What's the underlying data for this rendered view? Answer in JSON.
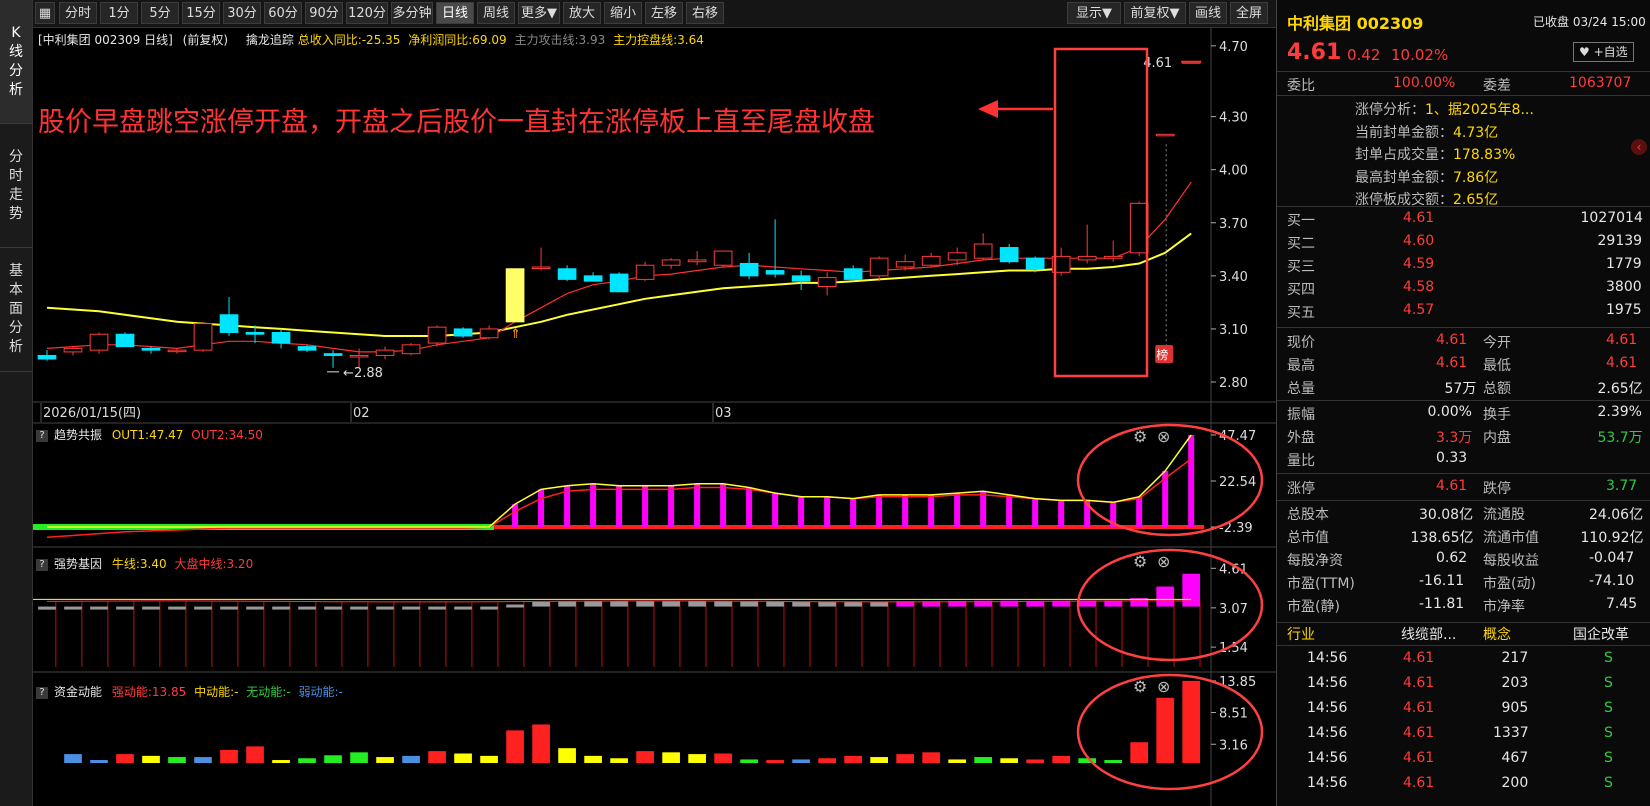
{
  "left_tabs": [
    {
      "label": "K\n线\n分\n析",
      "active": true
    },
    {
      "label": "分\n时\n走\n势",
      "active": false
    },
    {
      "label": "基\n本\n面\n分\n析",
      "active": false
    }
  ],
  "toolbar": {
    "period_buttons": [
      {
        "label": "分时",
        "active": false
      },
      {
        "label": "1分",
        "active": false
      },
      {
        "label": "5分",
        "active": false
      },
      {
        "label": "15分",
        "active": false
      },
      {
        "label": "30分",
        "active": false
      },
      {
        "label": "60分",
        "active": false
      },
      {
        "label": "90分",
        "active": false
      },
      {
        "label": "120分",
        "active": false
      },
      {
        "label": "多分钟",
        "active": false
      },
      {
        "label": "日线",
        "active": true
      },
      {
        "label": "周线",
        "active": false
      },
      {
        "label": "更多▼",
        "active": false
      },
      {
        "label": "放大",
        "active": false
      },
      {
        "label": "缩小",
        "active": false
      },
      {
        "label": "左移",
        "active": false
      },
      {
        "label": "右移",
        "active": false
      }
    ],
    "right_buttons": [
      {
        "label": "显示▼"
      },
      {
        "label": "前复权▼"
      },
      {
        "label": "画线"
      },
      {
        "label": "全屏"
      }
    ]
  },
  "main_chart": {
    "title": "[中利集团 002309 日线]",
    "adjust": "(前复权)",
    "indicator_name": "擒龙追踪",
    "ind1": "总收入同比:-25.35",
    "ind2": "净利润同比:69.09",
    "ind3": "主力攻击线:3.93",
    "ind4": "主力控盘线:3.64",
    "y_ticks": [
      "4.70",
      "4.30",
      "4.00",
      "3.70",
      "3.40",
      "3.10",
      "2.80"
    ],
    "x_labels": [
      "2026/01/15(四)",
      "02",
      "03"
    ],
    "low_mark": "2.88",
    "high_mark": "4.61",
    "badge": "榜",
    "annotation": "股价早盘跳空涨停开盘，开盘之后股价一直封在涨停板上直至尾盘收盘"
  },
  "panel1": {
    "name": "趋势共振",
    "out1": "OUT1:47.47",
    "out2": "OUT2:34.50",
    "y_ticks": [
      "47.47",
      "22.54",
      "-2.39"
    ]
  },
  "panel2": {
    "name": "强势基因",
    "l1": "牛线:3.40",
    "l2": "大盘中线:3.20",
    "y_ticks": [
      "4.61",
      "3.07",
      "1.54"
    ]
  },
  "panel3": {
    "name": "资金动能",
    "l1": "强动能:13.85",
    "l2": "中动能:-",
    "l3": "无动能:-",
    "l4": "弱动能:-",
    "y_ticks": [
      "13.85",
      "8.51",
      "3.16"
    ]
  },
  "colors": {
    "up": "#ff3b3b",
    "down": "#00e5ff",
    "ma_yellow": "#ffff33",
    "magenta": "#ff00ff",
    "green": "#22ee22"
  },
  "chart_data": {
    "type": "candlestick",
    "ylim": [
      2.8,
      4.75
    ],
    "candles": [
      [
        2.95,
        2.98,
        2.92,
        2.93
      ],
      [
        2.97,
        3.0,
        2.95,
        2.99
      ],
      [
        2.98,
        3.08,
        2.96,
        3.07
      ],
      [
        3.07,
        3.08,
        3.0,
        3.0
      ],
      [
        2.99,
        3.0,
        2.96,
        2.98
      ],
      [
        2.98,
        2.99,
        2.96,
        2.98
      ],
      [
        2.98,
        3.14,
        2.97,
        3.13
      ],
      [
        3.18,
        3.28,
        3.06,
        3.08
      ],
      [
        3.08,
        3.12,
        3.02,
        3.07
      ],
      [
        3.08,
        3.1,
        2.99,
        3.02
      ],
      [
        3.0,
        3.01,
        2.97,
        2.98
      ],
      [
        2.96,
        2.98,
        2.88,
        2.95
      ],
      [
        2.95,
        2.99,
        2.88,
        2.95
      ],
      [
        2.95,
        3.0,
        2.93,
        2.98
      ],
      [
        2.96,
        3.02,
        2.95,
        3.01
      ],
      [
        3.02,
        3.12,
        3.0,
        3.11
      ],
      [
        3.1,
        3.11,
        3.05,
        3.06
      ],
      [
        3.05,
        3.12,
        3.04,
        3.1
      ],
      [
        3.14,
        3.44,
        3.14,
        3.44
      ],
      [
        3.45,
        3.56,
        3.43,
        3.45
      ],
      [
        3.44,
        3.46,
        3.37,
        3.38
      ],
      [
        3.4,
        3.42,
        3.37,
        3.37
      ],
      [
        3.41,
        3.42,
        3.31,
        3.31
      ],
      [
        3.38,
        3.48,
        3.37,
        3.46
      ],
      [
        3.46,
        3.5,
        3.44,
        3.49
      ],
      [
        3.48,
        3.54,
        3.46,
        3.49
      ],
      [
        3.46,
        3.54,
        3.45,
        3.54
      ],
      [
        3.47,
        3.53,
        3.38,
        3.4
      ],
      [
        3.43,
        3.72,
        3.39,
        3.41
      ],
      [
        3.4,
        3.43,
        3.32,
        3.37
      ],
      [
        3.34,
        3.42,
        3.29,
        3.39
      ],
      [
        3.44,
        3.46,
        3.37,
        3.38
      ],
      [
        3.4,
        3.51,
        3.37,
        3.5
      ],
      [
        3.45,
        3.52,
        3.43,
        3.48
      ],
      [
        3.46,
        3.53,
        3.45,
        3.51
      ],
      [
        3.49,
        3.56,
        3.46,
        3.53
      ],
      [
        3.5,
        3.64,
        3.49,
        3.58
      ],
      [
        3.56,
        3.58,
        3.47,
        3.48
      ],
      [
        3.5,
        3.51,
        3.42,
        3.44
      ],
      [
        3.42,
        3.56,
        3.4,
        3.51
      ],
      [
        3.49,
        3.69,
        3.47,
        3.51
      ],
      [
        3.5,
        3.6,
        3.48,
        3.51
      ],
      [
        3.53,
        3.82,
        3.51,
        3.81
      ],
      [
        4.2,
        4.2,
        4.2,
        4.2
      ],
      [
        4.61,
        4.61,
        4.61,
        4.61
      ]
    ],
    "ma_red": [
      2.99,
      3.0,
      3.01,
      3.01,
      3.0,
      2.99,
      3.01,
      3.03,
      3.03,
      3.02,
      3.01,
      2.99,
      2.97,
      2.97,
      2.98,
      3.01,
      3.03,
      3.05,
      3.14,
      3.22,
      3.3,
      3.35,
      3.37,
      3.4,
      3.41,
      3.43,
      3.45,
      3.46,
      3.45,
      3.44,
      3.43,
      3.42,
      3.43,
      3.44,
      3.45,
      3.47,
      3.49,
      3.5,
      3.5,
      3.5,
      3.5,
      3.5,
      3.56,
      3.72,
      3.93
    ],
    "ma_yellow": [
      3.22,
      3.21,
      3.2,
      3.18,
      3.16,
      3.14,
      3.13,
      3.12,
      3.11,
      3.1,
      3.09,
      3.08,
      3.07,
      3.06,
      3.06,
      3.06,
      3.07,
      3.08,
      3.11,
      3.14,
      3.18,
      3.21,
      3.24,
      3.27,
      3.29,
      3.31,
      3.33,
      3.34,
      3.35,
      3.36,
      3.36,
      3.37,
      3.38,
      3.39,
      3.4,
      3.41,
      3.42,
      3.43,
      3.43,
      3.44,
      3.44,
      3.45,
      3.47,
      3.53,
      3.64
    ],
    "trend_out1": [
      -2.4,
      -2.4,
      -2.4,
      -2.4,
      -2.4,
      -2.4,
      -2.4,
      -2.4,
      -2.4,
      -2.4,
      -2.4,
      -2.4,
      -2.4,
      -2.4,
      -2.4,
      -2.4,
      -2.4,
      -2.4,
      10,
      18,
      20,
      21,
      20,
      20,
      20,
      21,
      21,
      19,
      16,
      14,
      14,
      13,
      15,
      15,
      15,
      16,
      17,
      15,
      13,
      12,
      12,
      11,
      14,
      28,
      47.47
    ],
    "trend_out2": [
      -8,
      -7,
      -6,
      -5,
      -4.5,
      -4,
      -3.5,
      -3,
      -3,
      -3,
      -3,
      -3,
      -3,
      -3,
      -3,
      -3,
      -3,
      -2.5,
      6,
      13,
      17,
      18,
      18,
      18,
      18,
      19,
      19,
      18,
      16,
      14,
      14,
      13,
      14,
      14,
      14,
      15,
      15,
      14,
      13,
      12,
      12,
      11,
      13,
      24,
      34.5
    ],
    "gene_bar": [
      3.0,
      3.02,
      3.05,
      3.05,
      3.04,
      3.03,
      3.05,
      3.07,
      3.07,
      3.06,
      3.05,
      3.04,
      3.03,
      3.03,
      3.04,
      3.06,
      3.07,
      3.09,
      3.2,
      3.3,
      3.33,
      3.33,
      3.32,
      3.33,
      3.33,
      3.34,
      3.34,
      3.33,
      3.32,
      3.31,
      3.31,
      3.31,
      3.32,
      3.33,
      3.33,
      3.34,
      3.35,
      3.35,
      3.34,
      3.35,
      3.36,
      3.36,
      3.45,
      3.9,
      4.4
    ],
    "money": [
      {
        "v": 1.5,
        "c": "#4a90e2"
      },
      {
        "v": 0.5,
        "c": "#4a90e2"
      },
      {
        "v": 1.5,
        "c": "#ff2020"
      },
      {
        "v": 1.2,
        "c": "#ffff00"
      },
      {
        "v": 1.0,
        "c": "#22ee22"
      },
      {
        "v": 1.0,
        "c": "#4a90e2"
      },
      {
        "v": 2.2,
        "c": "#ff2020"
      },
      {
        "v": 2.8,
        "c": "#ff2020"
      },
      {
        "v": 0.5,
        "c": "#ffff00"
      },
      {
        "v": 0.8,
        "c": "#22ee22"
      },
      {
        "v": 1.3,
        "c": "#22ee22"
      },
      {
        "v": 1.8,
        "c": "#22ee22"
      },
      {
        "v": 1.0,
        "c": "#ffff00"
      },
      {
        "v": 1.2,
        "c": "#4a90e2"
      },
      {
        "v": 2.0,
        "c": "#ff2020"
      },
      {
        "v": 1.6,
        "c": "#ffff00"
      },
      {
        "v": 1.2,
        "c": "#ffff00"
      },
      {
        "v": 5.5,
        "c": "#ff2020"
      },
      {
        "v": 6.5,
        "c": "#ff2020"
      },
      {
        "v": 2.5,
        "c": "#ffff00"
      },
      {
        "v": 1.2,
        "c": "#ffff00"
      },
      {
        "v": 0.8,
        "c": "#ffff00"
      },
      {
        "v": 2.0,
        "c": "#ff2020"
      },
      {
        "v": 1.8,
        "c": "#ffff00"
      },
      {
        "v": 1.5,
        "c": "#ffff00"
      },
      {
        "v": 1.6,
        "c": "#ff2020"
      },
      {
        "v": 0.6,
        "c": "#22ee22"
      },
      {
        "v": 0.5,
        "c": "#ff2020"
      },
      {
        "v": 0.6,
        "c": "#4a90e2"
      },
      {
        "v": 0.8,
        "c": "#ff2020"
      },
      {
        "v": 1.2,
        "c": "#ff2020"
      },
      {
        "v": 1.0,
        "c": "#ffff00"
      },
      {
        "v": 1.5,
        "c": "#ff2020"
      },
      {
        "v": 1.8,
        "c": "#ff2020"
      },
      {
        "v": 0.6,
        "c": "#ffff00"
      },
      {
        "v": 1.0,
        "c": "#22ee22"
      },
      {
        "v": 0.8,
        "c": "#ffff00"
      },
      {
        "v": 0.6,
        "c": "#ff2020"
      },
      {
        "v": 1.2,
        "c": "#ff2020"
      },
      {
        "v": 0.8,
        "c": "#22ee22"
      },
      {
        "v": 0.5,
        "c": "#22ee22"
      },
      {
        "v": 3.5,
        "c": "#ff2020"
      },
      {
        "v": 11,
        "c": "#ff2020"
      },
      {
        "v": 13.85,
        "c": "#ff2020"
      }
    ]
  },
  "right_panel": {
    "stock_name": "中利集团 002309",
    "status": "已收盘 03/24 15:00",
    "price": "4.61",
    "change": "0.42",
    "pct": "10.02%",
    "watch_btn": "+自选",
    "weibi_label": "委比",
    "weibi_val": "100.00%",
    "weicha_label": "委差",
    "weicha_val": "1063707",
    "analysis": [
      {
        "k": "涨停分析：",
        "v": "1、据2025年8..."
      },
      {
        "k": "当前封单金额：",
        "v": "4.73亿"
      },
      {
        "k": "封单占成交量：",
        "v": "178.83%"
      },
      {
        "k": "最高封单金额：",
        "v": "7.86亿"
      },
      {
        "k": "涨停板成交额：",
        "v": "2.65亿"
      }
    ],
    "bids": [
      {
        "l": "买一",
        "p": "4.61",
        "v": "1027014"
      },
      {
        "l": "买二",
        "p": "4.60",
        "v": "29139"
      },
      {
        "l": "买三",
        "p": "4.59",
        "v": "1779"
      },
      {
        "l": "买四",
        "p": "4.58",
        "v": "3800"
      },
      {
        "l": "买五",
        "p": "4.57",
        "v": "1975"
      }
    ],
    "quotes": [
      [
        {
          "l": "现价",
          "v": "4.61",
          "c": "red"
        },
        {
          "l": "今开",
          "v": "4.61",
          "c": "red"
        }
      ],
      [
        {
          "l": "最高",
          "v": "4.61",
          "c": "red"
        },
        {
          "l": "最低",
          "v": "4.61",
          "c": "red"
        }
      ],
      [
        {
          "l": "总量",
          "v": "57万",
          "c": "white"
        },
        {
          "l": "总额",
          "v": "2.65亿",
          "c": "white"
        }
      ]
    ],
    "stats1": [
      [
        {
          "l": "振幅",
          "v": "0.00%",
          "c": "white"
        },
        {
          "l": "换手",
          "v": "2.39%",
          "c": "white"
        }
      ],
      [
        {
          "l": "外盘",
          "v": "3.3万",
          "c": "red"
        },
        {
          "l": "内盘",
          "v": "53.7万",
          "c": "green"
        }
      ],
      [
        {
          "l": "量比",
          "v": "0.33",
          "c": "white"
        },
        {
          "l": "",
          "v": "",
          "c": "white"
        }
      ]
    ],
    "limits": [
      {
        "l": "涨停",
        "v": "4.61",
        "c": "red"
      },
      {
        "l": "跌停",
        "v": "3.77",
        "c": "green"
      }
    ],
    "stats2": [
      [
        {
          "l": "总股本",
          "v": "30.08亿"
        },
        {
          "l": "流通股",
          "v": "24.06亿"
        }
      ],
      [
        {
          "l": "总市值",
          "v": "138.65亿"
        },
        {
          "l": "流通市值",
          "v": "110.92亿"
        }
      ],
      [
        {
          "l": "每股净资",
          "v": "0.62"
        },
        {
          "l": "每股收益",
          "v": "-0.047"
        }
      ],
      [
        {
          "l": "市盈(TTM)",
          "v": "-16.11"
        },
        {
          "l": "市盈(动)",
          "v": "-74.10"
        }
      ],
      [
        {
          "l": "市盈(静)",
          "v": "-11.81"
        },
        {
          "l": "市净率",
          "v": "7.45"
        }
      ]
    ],
    "industry": {
      "l1": "行业",
      "v1": "线缆部...",
      "l2": "概念",
      "v2": "国企改革"
    },
    "trades": [
      {
        "t": "14:56",
        "p": "4.61",
        "v": "217",
        "s": "S"
      },
      {
        "t": "14:56",
        "p": "4.61",
        "v": "203",
        "s": "S"
      },
      {
        "t": "14:56",
        "p": "4.61",
        "v": "905",
        "s": "S"
      },
      {
        "t": "14:56",
        "p": "4.61",
        "v": "1337",
        "s": "S"
      },
      {
        "t": "14:56",
        "p": "4.61",
        "v": "467",
        "s": "S"
      },
      {
        "t": "14:56",
        "p": "4.61",
        "v": "200",
        "s": "S"
      }
    ]
  }
}
